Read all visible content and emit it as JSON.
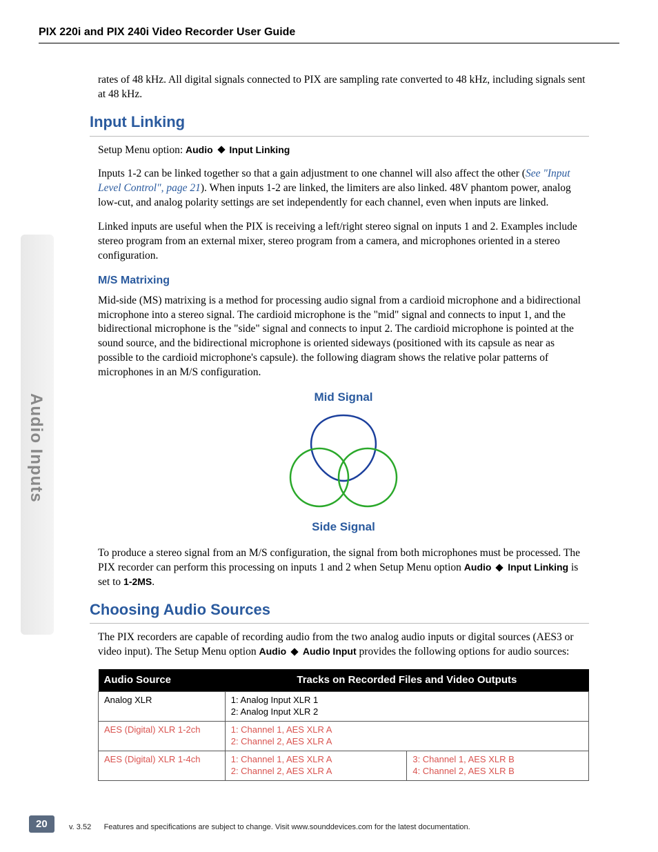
{
  "header": {
    "title": "PIX 220i and PIX 240i Video Recorder User Guide"
  },
  "side_tab": "Audio Inputs",
  "intro_para": "rates of 48 kHz. All digital signals connected to PIX are sampling rate converted to 48 kHz, including signals sent at 48 kHz.",
  "h_input_linking": "Input Linking",
  "setup_prefix": "Setup Menu option: ",
  "setup_audio": "Audio",
  "setup_linking": "Input Linking",
  "linking_p1_a": "Inputs 1-2 can be linked together so that a gain adjustment to one channel will also affect the other (",
  "linking_ref": "See \"Input Level Control\", page 21",
  "linking_p1_b": "). When inputs 1-2 are linked, the limiters are also linked. 48V phantom power, analog low-cut, and analog polarity settings are set independently for each channel, even when inputs are linked.",
  "linking_p2": "Linked inputs are useful when the PIX is receiving a left/right stereo signal on inputs 1 and 2. Examples include stereo program from an external mixer, stereo program from a camera, and microphones oriented in a stereo configuration.",
  "h_ms": "M/S Matrixing",
  "ms_p1": "Mid-side (MS) matrixing is a method for processing audio signal from a cardioid microphone and a bidirectional microphone into a stereo signal. The cardioid microphone is the \"mid\" signal and connects to input 1, and the bidirectional microphone is the \"side\" signal and connects to input 2. The cardioid microphone is pointed at the sound source, and the bidirectional microphone is oriented sideways (positioned with its capsule as near as possible to the cardioid microphone's capsule). the following diagram shows the relative polar patterns of microphones in an M/S configuration.",
  "diag_mid": "Mid Signal",
  "diag_side": "Side Signal",
  "ms_p2_a": "To produce a stereo signal from an M/S configuration, the signal from both microphones must be processed. The PIX recorder can perform this processing on inputs 1 and 2 when Setup Menu option ",
  "ms_p2_b": " is set to ",
  "ms_p2_val": "1-2MS",
  "ms_p2_c": ".",
  "h_sources": "Choosing Audio Sources",
  "src_p1_a": "The PIX recorders are capable of recording audio from the two analog audio inputs or digital sources (AES3 or video input). The Setup Menu option ",
  "src_menu_a": "Audio",
  "src_menu_b": "Audio Input",
  "src_p1_b": " provides the following options for audio sources:",
  "table": {
    "h1": "Audio Source",
    "h2": "Tracks on Recorded Files and Video Outputs",
    "rows": [
      {
        "src": "Analog XLR",
        "c1": "1: Analog Input XLR 1\n2: Analog Input XLR 2",
        "c2": ""
      },
      {
        "src": "AES (Digital) XLR 1-2ch",
        "c1": "1: Channel 1, AES XLR A\n2: Channel 2, AES XLR A",
        "c2": ""
      },
      {
        "src": "AES (Digital) XLR 1-4ch",
        "c1": "1: Channel 1, AES XLR A\n2: Channel 2, AES XLR A",
        "c2": "3: Channel 1, AES XLR B\n4: Channel 2, AES XLR B"
      }
    ]
  },
  "page_number": "20",
  "footer": {
    "ver": "v. 3.52",
    "text": "Features and specifications are subject to change. Visit www.sounddevices.com for the latest documentation."
  }
}
